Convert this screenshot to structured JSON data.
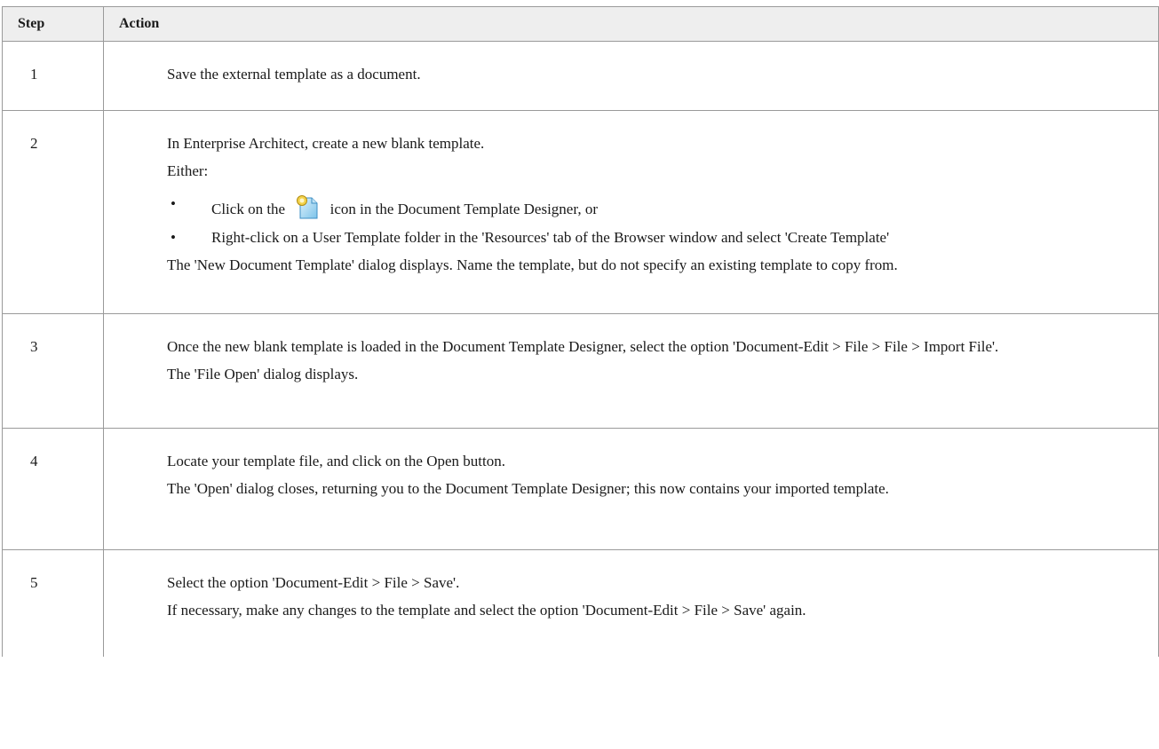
{
  "table": {
    "headers": [
      "Step",
      "Action"
    ],
    "rows": [
      {
        "step": "1",
        "lines": [
          "Save the external template as a document."
        ]
      },
      {
        "step": "2",
        "lines": [
          "In Enterprise Architect, create a new blank template.",
          "Either:"
        ],
        "bullets": [
          {
            "before": "Click on the",
            "icon": "new-template-icon",
            "after": "icon in the Document Template Designer, or"
          },
          {
            "text": "Right-click on a User Template folder in the 'Resources' tab of the Browser window and select 'Create Template'"
          }
        ],
        "after_lines": [
          "The 'New Document Template' dialog displays. Name the template, but do not specify an existing template to copy from."
        ]
      },
      {
        "step": "3",
        "lines": [
          "Once the new blank template is loaded in the Document Template Designer, select the option 'Document-Edit > File > File > Import File'.",
          "The 'File Open' dialog displays."
        ]
      },
      {
        "step": "4",
        "lines": [
          "Locate your template file, and click on the Open button.",
          "The 'Open' dialog closes, returning you to the Document Template Designer; this now contains your imported template."
        ]
      },
      {
        "step": "5",
        "lines": [
          "Select the option 'Document-Edit > File > Save'.",
          "If necessary, make any changes to the template and select the option 'Document-Edit > File > Save' again."
        ]
      }
    ],
    "bullet_glyph": "•"
  }
}
